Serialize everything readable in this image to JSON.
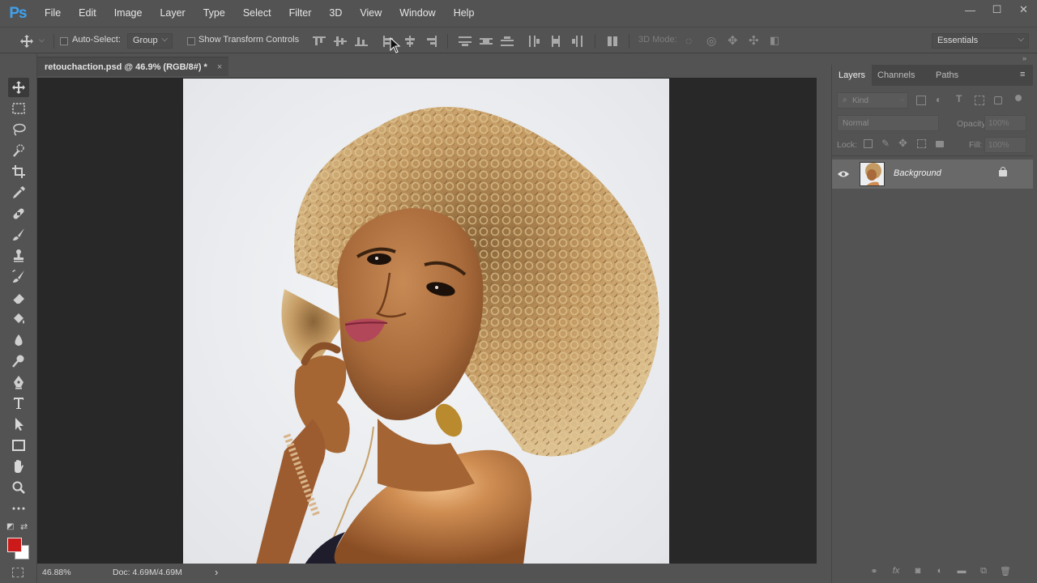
{
  "app": {
    "logo": "Ps"
  },
  "menu": [
    "File",
    "Edit",
    "Image",
    "Layer",
    "Type",
    "Select",
    "Filter",
    "3D",
    "View",
    "Window",
    "Help"
  ],
  "window_controls": {
    "minimize": "—",
    "maximize": "☐",
    "close": "✕"
  },
  "options_bar": {
    "auto_select_label": "Auto-Select:",
    "auto_select_value": "Group",
    "transform_label": "Show Transform Controls",
    "mode_3d_label": "3D Mode:",
    "workspace": "Essentials"
  },
  "document": {
    "tab_title": "retouchaction.psd @ 46.9% (RGB/8#) *",
    "close_glyph": "×"
  },
  "status": {
    "zoom": "46.88%",
    "doc_size": "Doc: 4.69M/4.69M",
    "arrow": "›"
  },
  "panel": {
    "tabs": [
      "Layers",
      "Channels",
      "Paths"
    ],
    "kind_label": "Kind",
    "blend_mode": "Normal",
    "opacity_label": "Opacity:",
    "opacity_value": "100%",
    "lock_label": "Lock:",
    "fill_label": "Fill:",
    "fill_value": "100%",
    "layers": [
      {
        "name": "Background"
      }
    ]
  },
  "colors": {
    "foreground": "#cc1a1a",
    "background": "#ffffff",
    "accent": "#3ea2f1"
  },
  "icons": [
    "move-icon",
    "marquee-icon",
    "lasso-icon",
    "quick-select-icon",
    "crop-icon",
    "eyedropper-icon",
    "healing-brush-icon",
    "brush-icon",
    "clone-stamp-icon",
    "history-brush-icon",
    "eraser-icon",
    "paint-bucket-icon",
    "blur-icon",
    "dodge-icon",
    "pen-icon",
    "type-icon",
    "path-select-icon",
    "rectangle-icon",
    "hand-icon",
    "zoom-icon",
    "more-tools-icon"
  ]
}
